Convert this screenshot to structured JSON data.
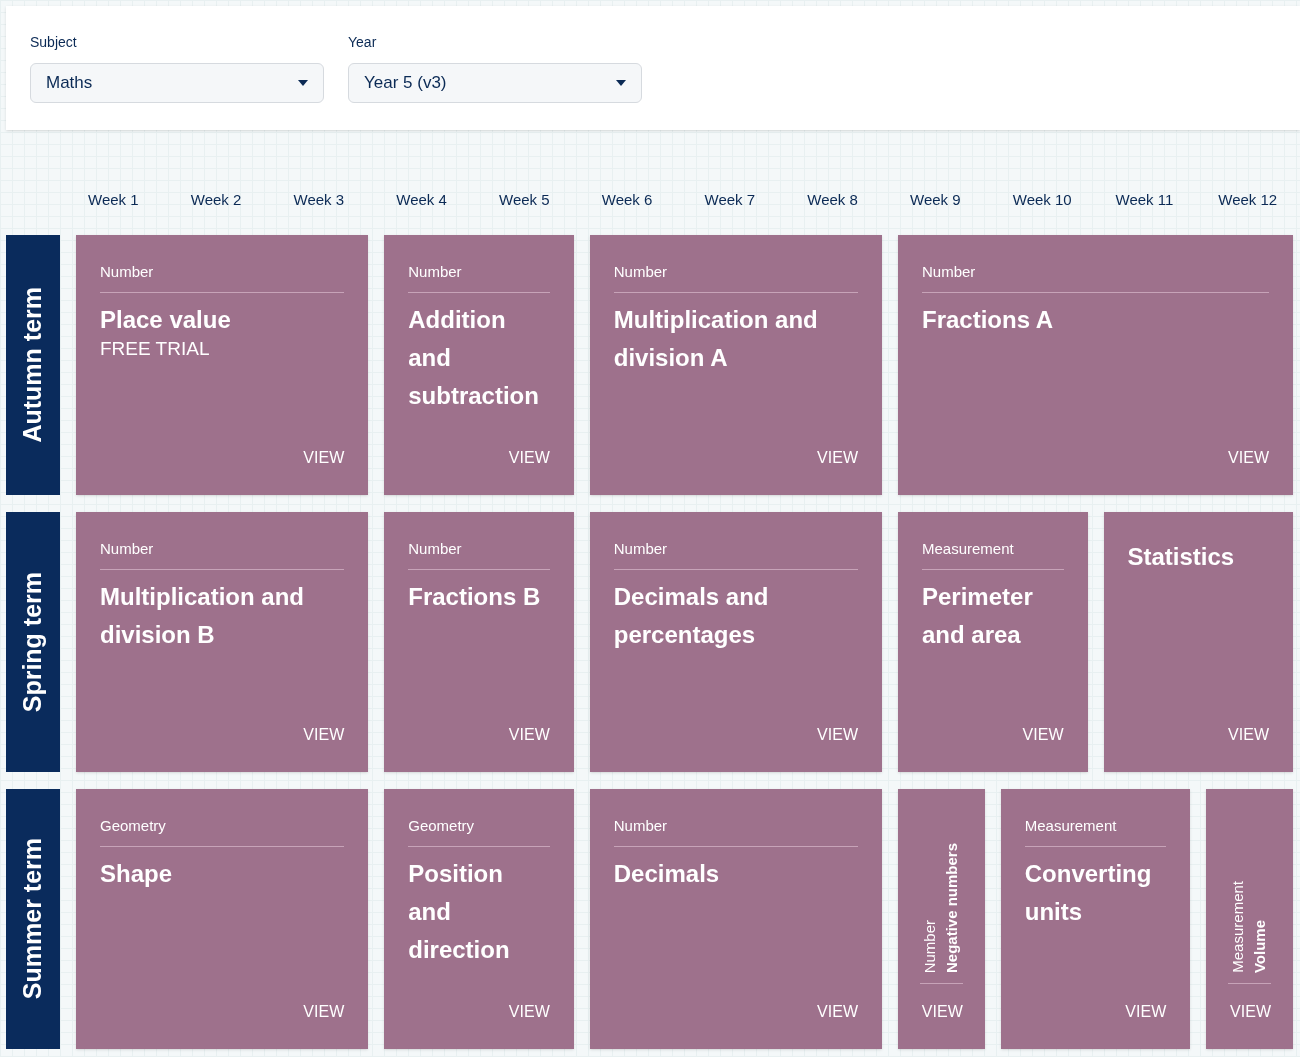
{
  "filters": [
    {
      "label": "Subject",
      "value": "Maths"
    },
    {
      "label": "Year",
      "value": "Year 5 (v3)"
    }
  ],
  "weeks": [
    "Week 1",
    "Week 2",
    "Week 3",
    "Week 4",
    "Week 5",
    "Week 6",
    "Week 7",
    "Week 8",
    "Week 9",
    "Week 10",
    "Week 11",
    "Week 12"
  ],
  "terms": [
    {
      "name": "Autumn term",
      "units": [
        {
          "kind": "full",
          "category": "Number",
          "title": "Place value",
          "note": "FREE TRIAL",
          "action": "VIEW"
        },
        {
          "kind": "full",
          "category": "Number",
          "title": "Addition and subtraction",
          "action": "VIEW"
        },
        {
          "kind": "full",
          "category": "Number",
          "title": "Multiplication and division A",
          "action": "VIEW"
        },
        {
          "kind": "full",
          "category": "Number",
          "title": "Fractions A",
          "action": "VIEW"
        }
      ]
    },
    {
      "name": "Spring term",
      "units": [
        {
          "kind": "full",
          "category": "Number",
          "title": "Multiplication and division B",
          "action": "VIEW"
        },
        {
          "kind": "full",
          "category": "Number",
          "title": "Fractions B",
          "action": "VIEW"
        },
        {
          "kind": "full",
          "category": "Number",
          "title": "Decimals and percentages",
          "action": "VIEW"
        },
        {
          "kind": "full",
          "category": "Measurement",
          "title": "Perimeter and area",
          "action": "VIEW"
        },
        {
          "kind": "title",
          "title": "Statistics",
          "action": "VIEW"
        }
      ]
    },
    {
      "name": "Summer term",
      "units": [
        {
          "kind": "full",
          "category": "Geometry",
          "title": "Shape",
          "action": "VIEW"
        },
        {
          "kind": "full",
          "category": "Geometry",
          "title": "Position and direction",
          "action": "VIEW"
        },
        {
          "kind": "full",
          "category": "Number",
          "title": "Decimals",
          "action": "VIEW"
        },
        {
          "kind": "vertical",
          "category": "Number",
          "title": "Negative numbers",
          "action": "VIEW"
        },
        {
          "kind": "full",
          "category": "Measurement",
          "title": "Converting units",
          "action": "VIEW"
        },
        {
          "kind": "vertical",
          "category": "Measurement",
          "title": "Volume",
          "action": "VIEW"
        }
      ]
    }
  ]
}
